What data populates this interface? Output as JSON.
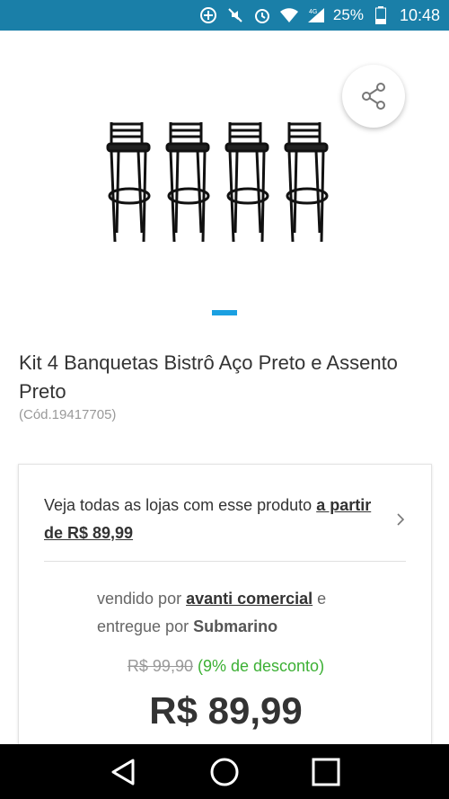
{
  "status_bar": {
    "battery": "25%",
    "time": "10:48",
    "network": "4G"
  },
  "product": {
    "title": "Kit 4 Banquetas Bistrô Aço Preto e Assento Preto",
    "code": "(Cód.19417705)"
  },
  "offer": {
    "all_stores_text": "Veja todas as lojas com esse produto ",
    "all_stores_price_link": "a partir de R$ 89,99",
    "sold_by_prefix": "vendido por ",
    "seller_name": "avanti comercial",
    "delivered_by_prefix": " e entregue por ",
    "delivered_by": "Submarino",
    "old_price": "R$ 99,90",
    "discount": "(9% de desconto)",
    "price": "R$ 89,99"
  },
  "colors": {
    "status_bar": "#1a7fa8",
    "carousel_indicator": "#1ba0e1",
    "discount": "#3cb034"
  }
}
